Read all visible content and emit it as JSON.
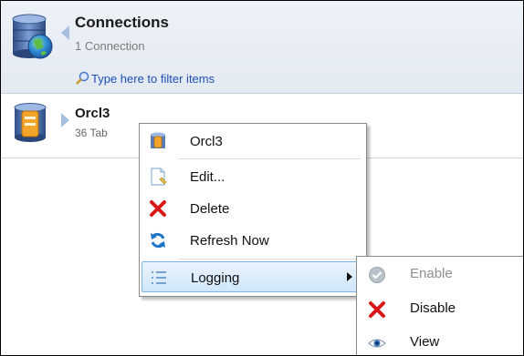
{
  "header": {
    "title": "Connections",
    "subtitle": "1 Connection",
    "filter_placeholder": "Type here to filter items"
  },
  "connection_item": {
    "name": "Orcl3",
    "subtitle_visible": "36 Tab"
  },
  "context_menu": {
    "items": [
      {
        "label": "Orcl3",
        "icon": "database-icon"
      },
      {
        "label": "Edit...",
        "icon": "edit-document-icon"
      },
      {
        "label": "Delete",
        "icon": "delete-x-icon"
      },
      {
        "label": "Refresh Now",
        "icon": "refresh-icon"
      },
      {
        "label": "Logging",
        "icon": "list-icon",
        "has_submenu": true,
        "highlighted": true
      }
    ]
  },
  "logging_submenu": {
    "items": [
      {
        "label": "Enable",
        "icon": "check-circle-icon",
        "disabled": true
      },
      {
        "label": "Disable",
        "icon": "delete-x-icon"
      },
      {
        "label": "View",
        "icon": "eye-icon"
      }
    ]
  },
  "colors": {
    "header_bg": "#e8edf5",
    "link": "#1f4fb6",
    "highlight": "#cfe6fa",
    "delete_red": "#d81818"
  }
}
